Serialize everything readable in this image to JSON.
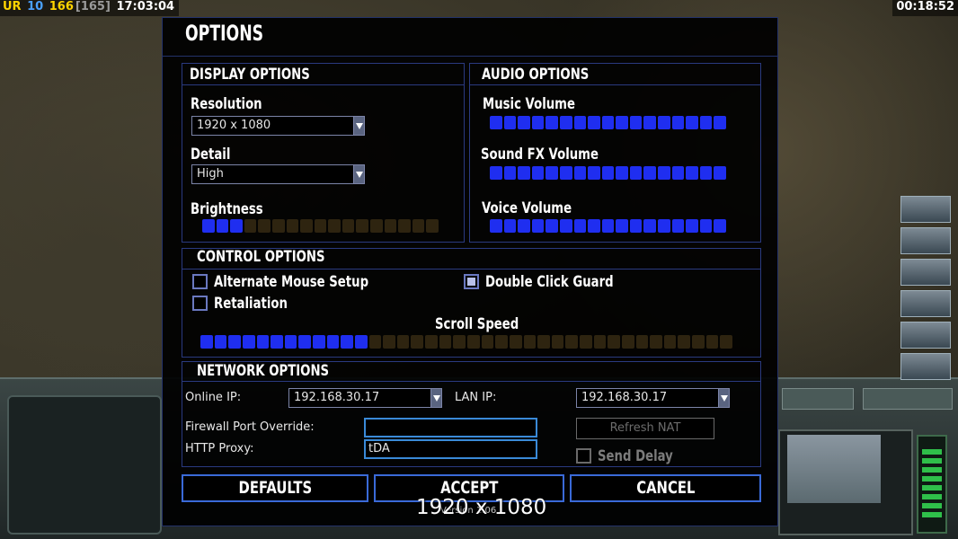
{
  "hud": {
    "stats": {
      "ur": "UR",
      "n1": "10",
      "n2": "166",
      "n3": "[165]",
      "clock": "17:03:04"
    },
    "timer": "00:18:52",
    "colors": {
      "ur": "#ffd400",
      "n1": "#4aa0ff",
      "n2": "#ffd400",
      "n3": "#9a9a9a"
    }
  },
  "dialog": {
    "title": "OPTIONS",
    "display": {
      "heading": "DISPLAY OPTIONS",
      "resolution_label": "Resolution",
      "resolution_value": "1920 x 1080",
      "detail_label": "Detail",
      "detail_value": "High",
      "brightness_label": "Brightness",
      "brightness_level": 3,
      "brightness_segments": 17
    },
    "audio": {
      "heading": "AUDIO OPTIONS",
      "music_label": "Music Volume",
      "music_level": 17,
      "sfx_label": "Sound FX Volume",
      "sfx_level": 17,
      "voice_label": "Voice Volume",
      "voice_level": 17,
      "segments": 17
    },
    "control": {
      "heading": "CONTROL OPTIONS",
      "alt_mouse_label": "Alternate Mouse Setup",
      "alt_mouse_checked": false,
      "retaliation_label": "Retaliation",
      "retaliation_checked": false,
      "double_click_label": "Double Click Guard",
      "double_click_checked": true,
      "scroll_label": "Scroll Speed",
      "scroll_level": 12,
      "scroll_segments": 38
    },
    "network": {
      "heading": "NETWORK OPTIONS",
      "online_ip_label": "Online IP:",
      "online_ip_value": "192.168.30.17",
      "lan_ip_label": "LAN IP:",
      "lan_ip_value": "192.168.30.17",
      "firewall_label": "Firewall Port Override:",
      "firewall_value": "",
      "proxy_label": "HTTP Proxy:",
      "proxy_value": "tDA",
      "refresh_nat_label": "Refresh NAT",
      "send_delay_label": "Send Delay",
      "send_delay_checked": false
    },
    "buttons": {
      "defaults": "DEFAULTS",
      "accept": "ACCEPT",
      "cancel": "CANCEL"
    },
    "version": "Version 1.06"
  },
  "overlay_resolution": "1920 x 1080",
  "colors": {
    "slider_on": "#1f2ef0",
    "slider_off": "#2e2410",
    "section_border": "#2a3a80",
    "button_border": "#3a6ad8"
  }
}
